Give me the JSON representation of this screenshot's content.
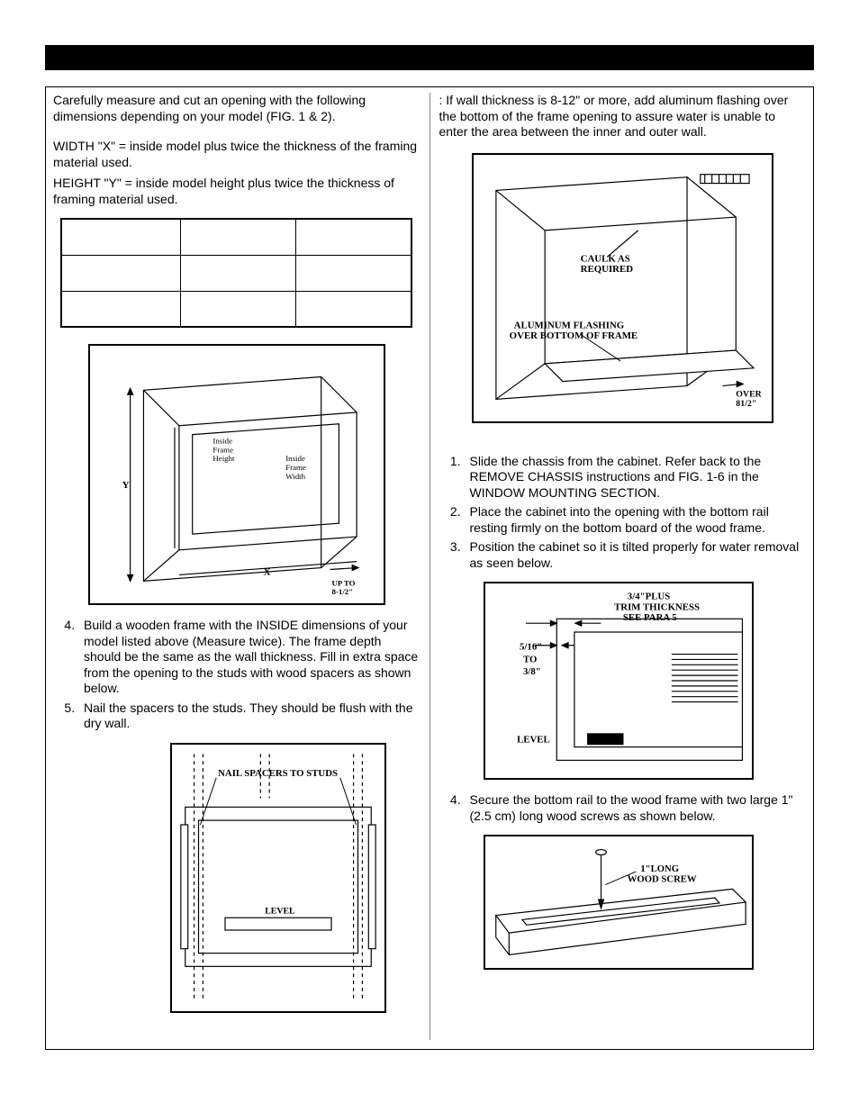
{
  "col1": {
    "p1": "Carefully measure and cut an opening with the following dimensions depending on your model (FIG. 1 & 2).",
    "p2": "WIDTH \"X\" = inside model plus twice the thickness of the framing material used.",
    "p3": "HEIGHT \"Y\" = inside model height plus twice the thickness of framing material used.",
    "li4": "Build a wooden frame with the INSIDE dimensions of your model listed above (Measure twice). The frame depth should be the same as the wall thickness. Fill in extra space from the opening to the studs with wood spacers as shown below.",
    "li5": "Nail the spacers to the studs. They should be flush with the dry wall."
  },
  "col2": {
    "p1": ": If wall thickness is 8-12\" or more, add aluminum flashing over the bottom of the frame opening to assure water is unable to enter the area between the inner and outer wall.",
    "li1": "Slide the chassis from the cabinet. Refer back to the REMOVE CHASSIS instructions and FIG. 1-6 in the WINDOW MOUNTING SECTION.",
    "li2": "Place the cabinet into the opening with the bottom rail resting firmly on the bottom board of the wood frame.",
    "li3": "Position the cabinet so it is tilted properly for water removal as seen below.",
    "li4": "Secure the bottom rail to the wood frame with two large 1\" (2.5 cm) long wood screws as shown below."
  },
  "figA": {
    "insideHeight": "Inside\nFrame\nHeight",
    "insideWidth": "Inside\nFrame\nWidth",
    "x": "X",
    "y": "Y",
    "upto": "UP TO\n8-1/2\""
  },
  "figB": {
    "nail": "NAIL SPACERS TO STUDS",
    "level": "LEVEL"
  },
  "figC": {
    "caulk": "CAULK AS\nREQUIRED",
    "flashing": "ALUMINUM FLASHING\nOVER BOTTOM OF FRAME",
    "over": "OVER\n81/2\""
  },
  "figD": {
    "top": "3/4\"PLUS\nTRIM THICKNESS\nSEE PARA 5",
    "side": "5/16\"\nTO\n3/8\"",
    "level": "LEVEL"
  },
  "figE": {
    "screw": "1\"LONG\nWOOD SCREW"
  }
}
